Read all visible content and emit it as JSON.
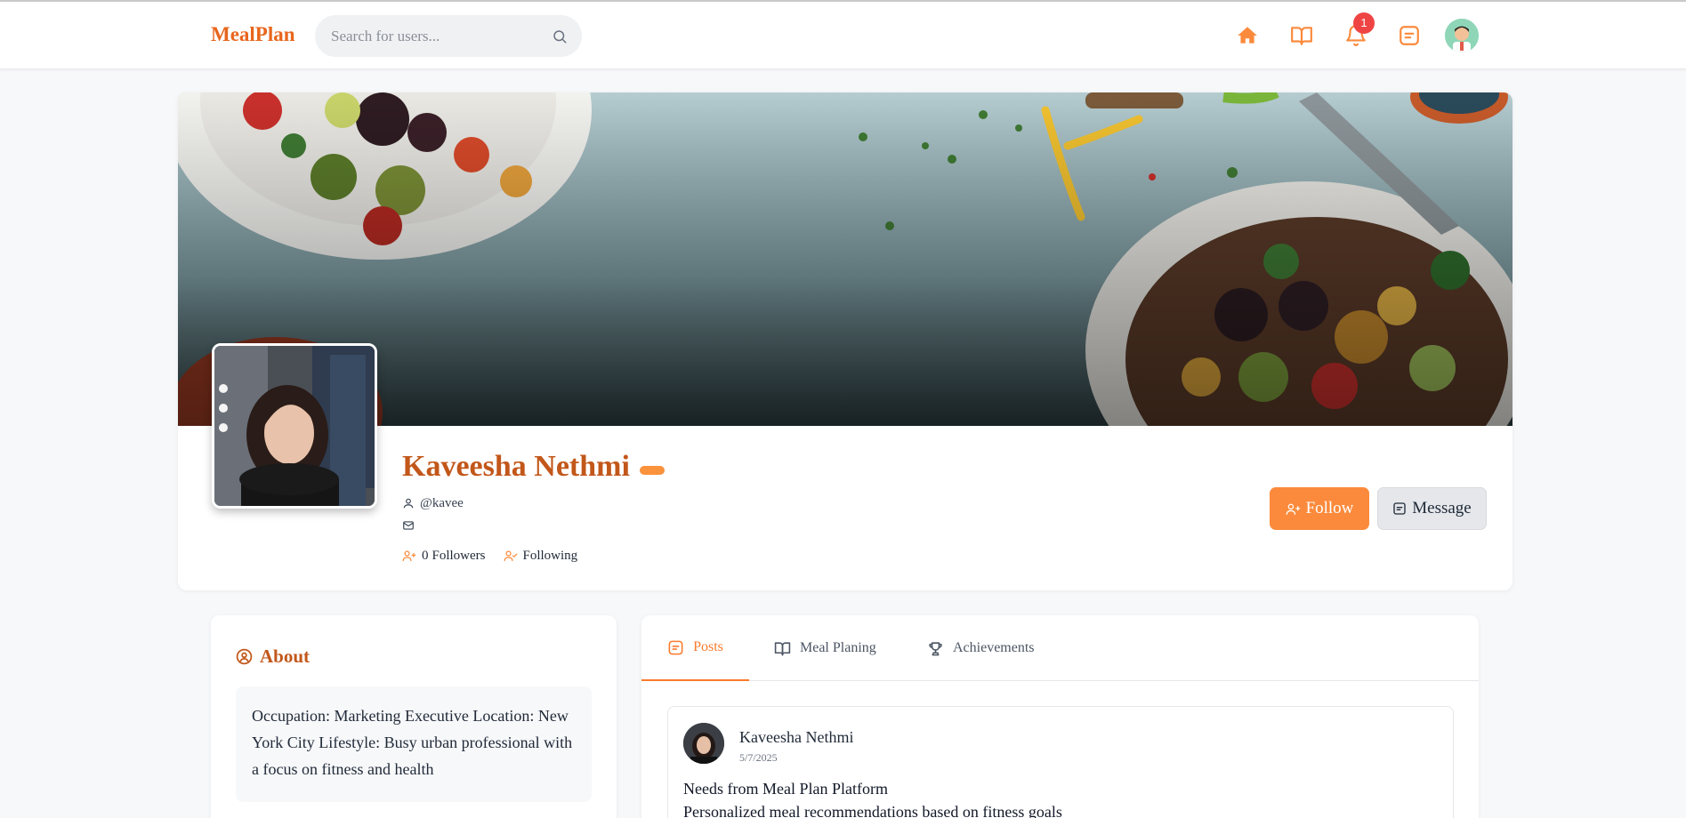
{
  "brand": "MealPlan",
  "search": {
    "placeholder": "Search for users..."
  },
  "nav": {
    "icons": [
      "home-icon",
      "book-icon",
      "bell-icon",
      "message-square-icon"
    ],
    "notification_count": "1"
  },
  "profile": {
    "name": "Kaveesha Nethmi",
    "username": "@kavee",
    "followers_count": "0",
    "followers_label": "Followers",
    "following_label": "Following",
    "follow_label": "Follow",
    "message_label": "Message"
  },
  "about": {
    "title": "About",
    "text": "Occupation: Marketing Executive Location: New York City Lifestyle: Busy urban professional with a focus on fitness and health"
  },
  "tabs": [
    {
      "label": "Posts",
      "icon": "posts-icon",
      "active": true
    },
    {
      "label": "Meal Planing",
      "icon": "book-icon",
      "active": false
    },
    {
      "label": "Achievements",
      "icon": "trophy-icon",
      "active": false
    }
  ],
  "post": {
    "author": "Kaveesha Nethmi",
    "date": "5/7/2025",
    "title": "Needs from Meal Plan Platform",
    "text": "Personalized meal recommendations based on fitness goals"
  },
  "colors": {
    "accent": "#fb8a3c",
    "brand": "#e8661c",
    "heading": "#c2571a",
    "badge": "#ef4444"
  }
}
